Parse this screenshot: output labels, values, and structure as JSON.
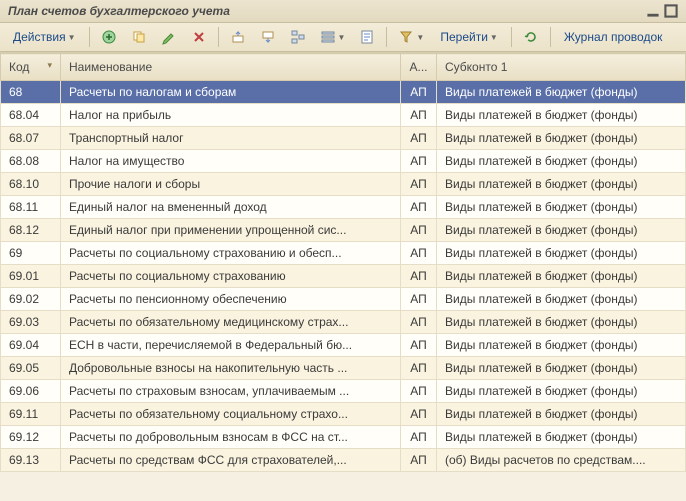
{
  "window": {
    "title": "План счетов бухгалтерского учета"
  },
  "toolbar": {
    "actions_label": "Действия",
    "goto_label": "Перейти",
    "journal_label": "Журнал проводок"
  },
  "columns": {
    "code": "Код",
    "name": "Наименование",
    "flag": "А...",
    "sub1": "Субконто 1"
  },
  "rows": [
    {
      "code": "68",
      "name": "Расчеты по налогам и сборам",
      "flag": "АП",
      "sub1": "Виды платежей в бюджет (фонды)",
      "selected": true
    },
    {
      "code": "68.04",
      "name": "Налог на прибыль",
      "flag": "АП",
      "sub1": "Виды платежей в бюджет (фонды)"
    },
    {
      "code": "68.07",
      "name": "Транспортный налог",
      "flag": "АП",
      "sub1": "Виды платежей в бюджет (фонды)"
    },
    {
      "code": "68.08",
      "name": "Налог на имущество",
      "flag": "АП",
      "sub1": "Виды платежей в бюджет (фонды)"
    },
    {
      "code": "68.10",
      "name": "Прочие налоги и сборы",
      "flag": "АП",
      "sub1": "Виды платежей в бюджет (фонды)"
    },
    {
      "code": "68.11",
      "name": "Единый налог на вмененный доход",
      "flag": "АП",
      "sub1": "Виды платежей в бюджет (фонды)"
    },
    {
      "code": "68.12",
      "name": "Единый налог при применении упрощенной сис...",
      "flag": "АП",
      "sub1": "Виды платежей в бюджет (фонды)"
    },
    {
      "code": "69",
      "name": "Расчеты по социальному страхованию и обесп...",
      "flag": "АП",
      "sub1": "Виды платежей в бюджет (фонды)"
    },
    {
      "code": "69.01",
      "name": "Расчеты по социальному страхованию",
      "flag": "АП",
      "sub1": "Виды платежей в бюджет (фонды)"
    },
    {
      "code": "69.02",
      "name": "Расчеты по пенсионному обеспечению",
      "flag": "АП",
      "sub1": "Виды платежей в бюджет (фонды)"
    },
    {
      "code": "69.03",
      "name": "Расчеты по обязательному медицинскому страх...",
      "flag": "АП",
      "sub1": "Виды платежей в бюджет (фонды)"
    },
    {
      "code": "69.04",
      "name": "ЕСН в части, перечисляемой в Федеральный бю...",
      "flag": "АП",
      "sub1": "Виды платежей в бюджет (фонды)"
    },
    {
      "code": "69.05",
      "name": "Добровольные взносы на накопительную часть ...",
      "flag": "АП",
      "sub1": "Виды платежей в бюджет (фонды)"
    },
    {
      "code": "69.06",
      "name": "Расчеты по страховым взносам, уплачиваемым ...",
      "flag": "АП",
      "sub1": "Виды платежей в бюджет (фонды)"
    },
    {
      "code": "69.11",
      "name": "Расчеты по обязательному социальному страхо...",
      "flag": "АП",
      "sub1": "Виды платежей в бюджет (фонды)"
    },
    {
      "code": "69.12",
      "name": "Расчеты по добровольным взносам в ФСС на ст...",
      "flag": "АП",
      "sub1": "Виды платежей в бюджет (фонды)"
    },
    {
      "code": "69.13",
      "name": "Расчеты по средствам ФСС для страхователей,...",
      "flag": "АП",
      "sub1": "(об) Виды расчетов по средствам...."
    }
  ]
}
